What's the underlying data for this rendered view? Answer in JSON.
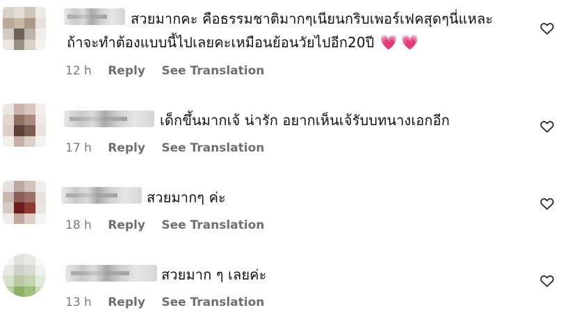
{
  "comments": [
    {
      "text_line1": "สวยมากคะ คือธรรมชาติมากๆเนียนกริบเพอร์เฟคสุดๆนี่แหละ",
      "text_line2": "ถ้าจะทำต้องแบบนี้ไปเลยคะเหมือนย้อนวัยไปอีก20ปี",
      "hearts": "💗💗",
      "time": "12 h",
      "reply": "Reply",
      "translate": "See Translation"
    },
    {
      "text_line1": "เด็กขึ้นมากเจ้ น่ารัก อยากเห็นเจ้รับบทนางเอกอีก",
      "time": "17 h",
      "reply": "Reply",
      "translate": "See Translation"
    },
    {
      "text_line1": "สวยมากๆ ค่ะ",
      "time": "18 h",
      "reply": "Reply",
      "translate": "See Translation"
    },
    {
      "text_line1": "สวยมาก ๆ เลยค่ะ",
      "time": "13 h",
      "reply": "Reply",
      "translate": "See Translation"
    }
  ],
  "icons": {
    "like": "heart-outline-icon"
  },
  "colors": {
    "meta_text": "#7a7a7a",
    "heart_emoji": "#ee3d6a"
  }
}
